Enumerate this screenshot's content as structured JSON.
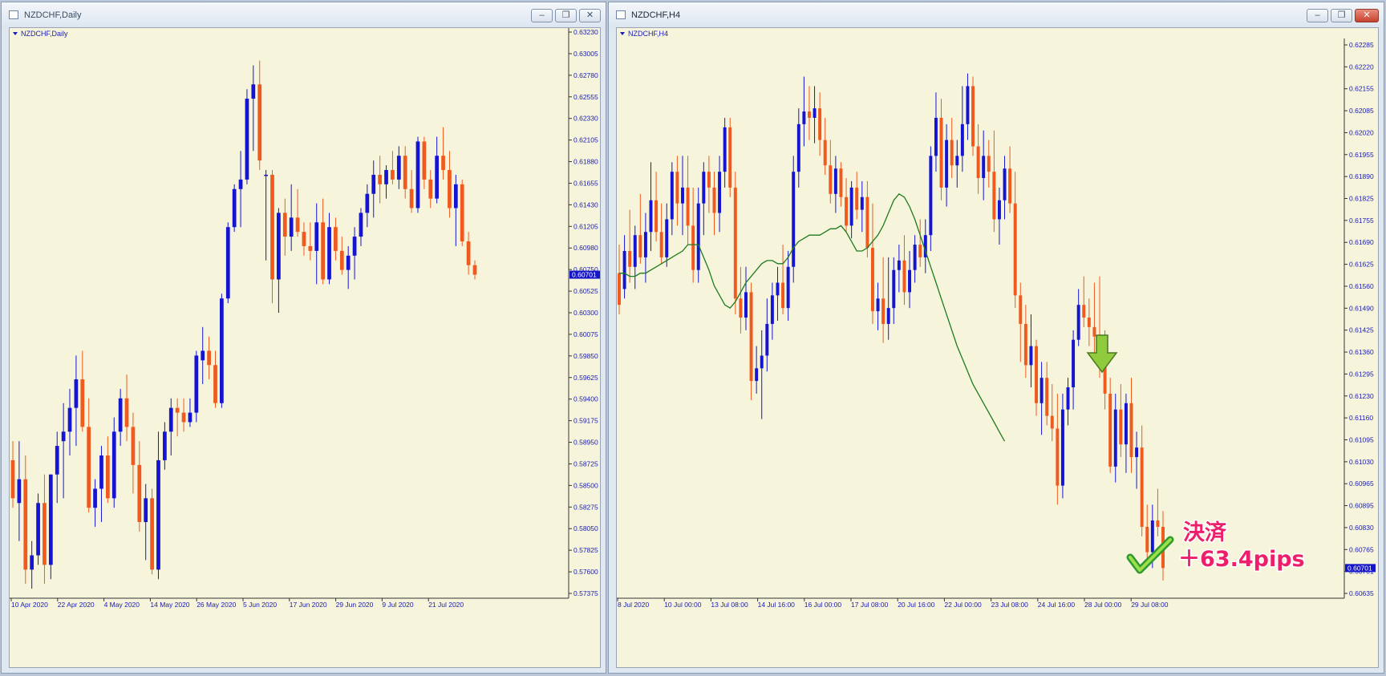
{
  "left": {
    "window_title": "NZDCHF,Daily",
    "chart_label": "NZDCHF,Daily",
    "price_marker": "0.60701",
    "price_ticks": [
      "0.63230",
      "0.63005",
      "0.62780",
      "0.62555",
      "0.62330",
      "0.62105",
      "0.61880",
      "0.61655",
      "0.61430",
      "0.61205",
      "0.60980",
      "0.60750",
      "0.60525",
      "0.60300",
      "0.60075",
      "0.59850",
      "0.59625",
      "0.59400",
      "0.59175",
      "0.58950",
      "0.58725",
      "0.58500",
      "0.58275",
      "0.58050",
      "0.57825",
      "0.57600",
      "0.57375"
    ],
    "time_ticks": [
      "10 Apr 2020",
      "22 Apr 2020",
      "4 May 2020",
      "14 May 2020",
      "26 May 2020",
      "5 Jun 2020",
      "17 Jun 2020",
      "29 Jun 2020",
      "9 Jul 2020",
      "21 Jul 2020"
    ]
  },
  "right": {
    "window_title": "NZDCHF,H4",
    "chart_label": "NZDCHF,H4",
    "price_marker": "0.60701",
    "price_ticks": [
      "0.62285",
      "0.62220",
      "0.62155",
      "0.62085",
      "0.62020",
      "0.61955",
      "0.61890",
      "0.61825",
      "0.61755",
      "0.61690",
      "0.61625",
      "0.61560",
      "0.61490",
      "0.61425",
      "0.61360",
      "0.61295",
      "0.61230",
      "0.61160",
      "0.61095",
      "0.61030",
      "0.60965",
      "0.60895",
      "0.60830",
      "0.60765",
      "0.60701",
      "0.60635"
    ],
    "time_ticks": [
      "8 Jul 2020",
      "10 Jul 00:00",
      "13 Jul 08:00",
      "14 Jul 16:00",
      "16 Jul 00:00",
      "17 Jul 08:00",
      "20 Jul 16:00",
      "22 Jul 00:00",
      "23 Jul 08:00",
      "24 Jul 16:00",
      "28 Jul 00:00",
      "29 Jul 08:00"
    ],
    "annotation_line1": "決済",
    "annotation_line2": "＋63.4pips"
  },
  "colors": {
    "bull": "#1414d2",
    "bear": "#f05a1e",
    "ma": "#1e7a1e",
    "axis_text": "#1a1ab4",
    "annotation": "#ee1f6a"
  },
  "chart_data": [
    {
      "type": "candlestick",
      "title": "NZDCHF,Daily",
      "ylim": [
        0.5735,
        0.6325
      ],
      "ohlc": [
        [
          0.5875,
          0.5895,
          0.5825,
          0.5835
        ],
        [
          0.583,
          0.5895,
          0.579,
          0.5855
        ],
        [
          0.5855,
          0.588,
          0.5745,
          0.576
        ],
        [
          0.576,
          0.579,
          0.574,
          0.5775
        ],
        [
          0.5775,
          0.584,
          0.5765,
          0.583
        ],
        [
          0.583,
          0.586,
          0.5745,
          0.5765
        ],
        [
          0.5765,
          0.586,
          0.575,
          0.586
        ],
        [
          0.586,
          0.5905,
          0.583,
          0.589
        ],
        [
          0.5895,
          0.5935,
          0.5835,
          0.5905
        ],
        [
          0.5905,
          0.595,
          0.588,
          0.593
        ],
        [
          0.593,
          0.5985,
          0.589,
          0.596
        ],
        [
          0.596,
          0.599,
          0.5905,
          0.591
        ],
        [
          0.591,
          0.594,
          0.582,
          0.5825
        ],
        [
          0.5825,
          0.5855,
          0.5805,
          0.5845
        ],
        [
          0.5845,
          0.589,
          0.581,
          0.588
        ],
        [
          0.588,
          0.59,
          0.583,
          0.5835
        ],
        [
          0.5835,
          0.592,
          0.5825,
          0.5905
        ],
        [
          0.5905,
          0.595,
          0.589,
          0.594
        ],
        [
          0.594,
          0.5965,
          0.5895,
          0.591
        ],
        [
          0.591,
          0.5925,
          0.584,
          0.587
        ],
        [
          0.587,
          0.5895,
          0.58,
          0.581
        ],
        [
          0.581,
          0.585,
          0.577,
          0.5835
        ],
        [
          0.5835,
          0.5845,
          0.5755,
          0.576
        ],
        [
          0.576,
          0.5905,
          0.575,
          0.5875
        ],
        [
          0.5875,
          0.5915,
          0.5865,
          0.5905
        ],
        [
          0.5905,
          0.594,
          0.588,
          0.593
        ],
        [
          0.593,
          0.594,
          0.59,
          0.5925
        ],
        [
          0.5925,
          0.594,
          0.5905,
          0.5915
        ],
        [
          0.5915,
          0.594,
          0.591,
          0.5925
        ],
        [
          0.5925,
          0.599,
          0.5915,
          0.5985
        ],
        [
          0.598,
          0.6015,
          0.5955,
          0.599
        ],
        [
          0.599,
          0.6005,
          0.596,
          0.5975
        ],
        [
          0.5975,
          0.599,
          0.593,
          0.5935
        ],
        [
          0.5935,
          0.605,
          0.593,
          0.6045
        ],
        [
          0.6045,
          0.6125,
          0.604,
          0.612
        ],
        [
          0.612,
          0.6165,
          0.6115,
          0.616
        ],
        [
          0.616,
          0.62,
          0.612,
          0.617
        ],
        [
          0.617,
          0.6265,
          0.6165,
          0.6255
        ],
        [
          0.6255,
          0.629,
          0.62,
          0.627
        ],
        [
          0.627,
          0.6295,
          0.618,
          0.619
        ],
        [
          0.6175,
          0.618,
          0.6085,
          0.6175
        ],
        [
          0.6175,
          0.618,
          0.604,
          0.6065
        ],
        [
          0.6065,
          0.614,
          0.603,
          0.6135
        ],
        [
          0.6135,
          0.615,
          0.609,
          0.611
        ],
        [
          0.611,
          0.6165,
          0.6095,
          0.613
        ],
        [
          0.613,
          0.616,
          0.611,
          0.6115
        ],
        [
          0.6115,
          0.6125,
          0.609,
          0.61
        ],
        [
          0.61,
          0.6125,
          0.6085,
          0.6095
        ],
        [
          0.6095,
          0.6145,
          0.606,
          0.6125
        ],
        [
          0.6125,
          0.615,
          0.606,
          0.6065
        ],
        [
          0.6065,
          0.6135,
          0.606,
          0.612
        ],
        [
          0.612,
          0.613,
          0.6085,
          0.6095
        ],
        [
          0.6095,
          0.611,
          0.607,
          0.6075
        ],
        [
          0.6075,
          0.61,
          0.6055,
          0.609
        ],
        [
          0.609,
          0.612,
          0.6065,
          0.611
        ],
        [
          0.611,
          0.614,
          0.61,
          0.6135
        ],
        [
          0.6135,
          0.6165,
          0.612,
          0.6155
        ],
        [
          0.6155,
          0.619,
          0.613,
          0.6175
        ],
        [
          0.6175,
          0.6195,
          0.6145,
          0.6165
        ],
        [
          0.6165,
          0.6185,
          0.615,
          0.618
        ],
        [
          0.618,
          0.62,
          0.6165,
          0.617
        ],
        [
          0.617,
          0.6205,
          0.616,
          0.6195
        ],
        [
          0.6195,
          0.6205,
          0.615,
          0.616
        ],
        [
          0.616,
          0.618,
          0.6135,
          0.614
        ],
        [
          0.614,
          0.6215,
          0.6135,
          0.621
        ],
        [
          0.621,
          0.6215,
          0.616,
          0.617
        ],
        [
          0.617,
          0.618,
          0.614,
          0.615
        ],
        [
          0.615,
          0.6215,
          0.6145,
          0.6195
        ],
        [
          0.6195,
          0.6225,
          0.617,
          0.618
        ],
        [
          0.618,
          0.62,
          0.613,
          0.614
        ],
        [
          0.614,
          0.6175,
          0.61,
          0.6165
        ],
        [
          0.6165,
          0.617,
          0.61,
          0.6105
        ],
        [
          0.6105,
          0.6115,
          0.607,
          0.608
        ],
        [
          0.608,
          0.6085,
          0.6065,
          0.607
        ]
      ]
    },
    {
      "type": "candlestick",
      "title": "NZDCHF,H4",
      "ylim": [
        0.6062,
        0.6235
      ],
      "ohlc": [
        [
          0.6163,
          0.6172,
          0.615,
          0.6153
        ],
        [
          0.6158,
          0.6175,
          0.6155,
          0.617
        ],
        [
          0.617,
          0.6183,
          0.616,
          0.6165
        ],
        [
          0.6165,
          0.6178,
          0.6158,
          0.6175
        ],
        [
          0.6175,
          0.6188,
          0.6166,
          0.6168
        ],
        [
          0.6168,
          0.6182,
          0.616,
          0.6176
        ],
        [
          0.6176,
          0.6198,
          0.617,
          0.6186
        ],
        [
          0.6186,
          0.6195,
          0.6173,
          0.6176
        ],
        [
          0.6176,
          0.6185,
          0.6166,
          0.6168
        ],
        [
          0.6168,
          0.6185,
          0.6165,
          0.618
        ],
        [
          0.618,
          0.6198,
          0.6175,
          0.6195
        ],
        [
          0.6195,
          0.62,
          0.6178,
          0.6185
        ],
        [
          0.6185,
          0.62,
          0.6175,
          0.619
        ],
        [
          0.619,
          0.62,
          0.6172,
          0.6178
        ],
        [
          0.6178,
          0.619,
          0.616,
          0.6164
        ],
        [
          0.6164,
          0.619,
          0.616,
          0.6185
        ],
        [
          0.6185,
          0.6198,
          0.6175,
          0.6195
        ],
        [
          0.6195,
          0.62,
          0.6182,
          0.619
        ],
        [
          0.619,
          0.6195,
          0.6175,
          0.6182
        ],
        [
          0.6182,
          0.62,
          0.6176,
          0.6195
        ],
        [
          0.6195,
          0.6212,
          0.619,
          0.6209
        ],
        [
          0.6209,
          0.6212,
          0.6187,
          0.619
        ],
        [
          0.619,
          0.6195,
          0.615,
          0.6155
        ],
        [
          0.6155,
          0.6165,
          0.6144,
          0.6149
        ],
        [
          0.6149,
          0.6165,
          0.6145,
          0.6157
        ],
        [
          0.6157,
          0.616,
          0.6123,
          0.6129
        ],
        [
          0.6129,
          0.614,
          0.6125,
          0.6133
        ],
        [
          0.6133,
          0.6145,
          0.6117,
          0.6137
        ],
        [
          0.6137,
          0.6155,
          0.6132,
          0.6147
        ],
        [
          0.6147,
          0.616,
          0.6142,
          0.6156
        ],
        [
          0.6156,
          0.6165,
          0.6148,
          0.616
        ],
        [
          0.616,
          0.6172,
          0.615,
          0.6152
        ],
        [
          0.6152,
          0.617,
          0.6148,
          0.6165
        ],
        [
          0.6165,
          0.62,
          0.616,
          0.6195
        ],
        [
          0.6195,
          0.6215,
          0.619,
          0.621
        ],
        [
          0.621,
          0.6225,
          0.6203,
          0.6214
        ],
        [
          0.6214,
          0.6222,
          0.6205,
          0.6212
        ],
        [
          0.6212,
          0.6222,
          0.6204,
          0.6215
        ],
        [
          0.6215,
          0.622,
          0.62,
          0.6205
        ],
        [
          0.6205,
          0.6212,
          0.6194,
          0.6197
        ],
        [
          0.6197,
          0.6205,
          0.6185,
          0.6188
        ],
        [
          0.6188,
          0.62,
          0.6182,
          0.6196
        ],
        [
          0.6196,
          0.6198,
          0.6184,
          0.6187
        ],
        [
          0.6187,
          0.6193,
          0.6176,
          0.6178
        ],
        [
          0.6178,
          0.6192,
          0.6174,
          0.619
        ],
        [
          0.619,
          0.6195,
          0.618,
          0.6183
        ],
        [
          0.6183,
          0.6192,
          0.6176,
          0.6187
        ],
        [
          0.6187,
          0.6192,
          0.6168,
          0.6171
        ],
        [
          0.6171,
          0.6185,
          0.6147,
          0.6151
        ],
        [
          0.6151,
          0.616,
          0.6145,
          0.6155
        ],
        [
          0.6155,
          0.6168,
          0.6141,
          0.6147
        ],
        [
          0.6147,
          0.6168,
          0.6142,
          0.6152
        ],
        [
          0.6152,
          0.6168,
          0.6147,
          0.6164
        ],
        [
          0.6164,
          0.6172,
          0.6157,
          0.6167
        ],
        [
          0.6167,
          0.6175,
          0.6153,
          0.6157
        ],
        [
          0.6157,
          0.617,
          0.6152,
          0.6164
        ],
        [
          0.6164,
          0.6175,
          0.616,
          0.6172
        ],
        [
          0.6172,
          0.618,
          0.6165,
          0.6168
        ],
        [
          0.6168,
          0.618,
          0.6163,
          0.6175
        ],
        [
          0.6175,
          0.6203,
          0.617,
          0.62
        ],
        [
          0.62,
          0.622,
          0.6195,
          0.6212
        ],
        [
          0.6212,
          0.6218,
          0.6186,
          0.619
        ],
        [
          0.619,
          0.621,
          0.6184,
          0.6205
        ],
        [
          0.6205,
          0.6212,
          0.6193,
          0.6197
        ],
        [
          0.6197,
          0.6205,
          0.619,
          0.62
        ],
        [
          0.62,
          0.6222,
          0.6195,
          0.621
        ],
        [
          0.621,
          0.6226,
          0.6205,
          0.6222
        ],
        [
          0.6222,
          0.6225,
          0.62,
          0.6203
        ],
        [
          0.6203,
          0.621,
          0.6188,
          0.6193
        ],
        [
          0.6193,
          0.6208,
          0.6186,
          0.62
        ],
        [
          0.62,
          0.6205,
          0.619,
          0.6195
        ],
        [
          0.6195,
          0.6208,
          0.6176,
          0.618
        ],
        [
          0.618,
          0.619,
          0.6172,
          0.6186
        ],
        [
          0.6186,
          0.62,
          0.618,
          0.6196
        ],
        [
          0.6196,
          0.6203,
          0.6182,
          0.6185
        ],
        [
          0.6185,
          0.6195,
          0.6152,
          0.6156
        ],
        [
          0.6156,
          0.616,
          0.6135,
          0.6147
        ],
        [
          0.6147,
          0.6153,
          0.613,
          0.6134
        ],
        [
          0.6134,
          0.615,
          0.6127,
          0.614
        ],
        [
          0.614,
          0.6142,
          0.6118,
          0.6122
        ],
        [
          0.6122,
          0.6135,
          0.6112,
          0.613
        ],
        [
          0.613,
          0.6135,
          0.6115,
          0.6118
        ],
        [
          0.6118,
          0.6128,
          0.611,
          0.6114
        ],
        [
          0.6114,
          0.6125,
          0.609,
          0.6096
        ],
        [
          0.6096,
          0.6125,
          0.6092,
          0.612
        ],
        [
          0.612,
          0.613,
          0.6115,
          0.6127
        ],
        [
          0.6127,
          0.6145,
          0.612,
          0.6142
        ],
        [
          0.6142,
          0.6158,
          0.614,
          0.6153
        ],
        [
          0.6153,
          0.6162,
          0.6146,
          0.6149
        ],
        [
          0.6149,
          0.6155,
          0.614,
          0.6146
        ],
        [
          0.6146,
          0.616,
          0.6138,
          0.6143
        ],
        [
          0.6143,
          0.6162,
          0.613,
          0.6135
        ],
        [
          0.6135,
          0.6145,
          0.612,
          0.6125
        ],
        [
          0.6125,
          0.613,
          0.61,
          0.6102
        ],
        [
          0.6102,
          0.6125,
          0.6097,
          0.612
        ],
        [
          0.612,
          0.6128,
          0.6105,
          0.6109
        ],
        [
          0.6109,
          0.6125,
          0.61,
          0.6122
        ],
        [
          0.6122,
          0.613,
          0.61,
          0.6105
        ],
        [
          0.6105,
          0.6113,
          0.6095,
          0.6108
        ],
        [
          0.6108,
          0.6115,
          0.608,
          0.6083
        ],
        [
          0.6083,
          0.609,
          0.6072,
          0.6075
        ],
        [
          0.6075,
          0.609,
          0.607,
          0.6085
        ],
        [
          0.6085,
          0.6095,
          0.608,
          0.6083
        ],
        [
          0.6083,
          0.6088,
          0.6066,
          0.607
        ]
      ],
      "series": [
        {
          "type": "line",
          "values": [
            0.6163,
            0.6163,
            0.6162,
            0.6162,
            0.6163,
            0.6163,
            0.6164,
            0.6165,
            0.6166,
            0.6167,
            0.6168,
            0.6169,
            0.617,
            0.6172,
            0.6172,
            0.6172,
            0.6168,
            0.6164,
            0.6159,
            0.6156,
            0.6153,
            0.6152,
            0.6154,
            0.6157,
            0.616,
            0.6162,
            0.6164,
            0.6166,
            0.6167,
            0.6167,
            0.6166,
            0.6166,
            0.6168,
            0.6171,
            0.6173,
            0.6174,
            0.6175,
            0.6175,
            0.6175,
            0.6176,
            0.6177,
            0.6177,
            0.6178,
            0.6176,
            0.6173,
            0.617,
            0.617,
            0.6171,
            0.6173,
            0.6175,
            0.6178,
            0.6182,
            0.6186,
            0.6188,
            0.6187,
            0.6184,
            0.618,
            0.6175,
            0.617,
            0.6165,
            0.616,
            0.6155,
            0.615,
            0.6145,
            0.614,
            0.6136,
            0.6132,
            0.6128,
            0.6125,
            0.6122,
            0.6119,
            0.6116,
            0.6113,
            0.611
          ]
        }
      ]
    }
  ]
}
